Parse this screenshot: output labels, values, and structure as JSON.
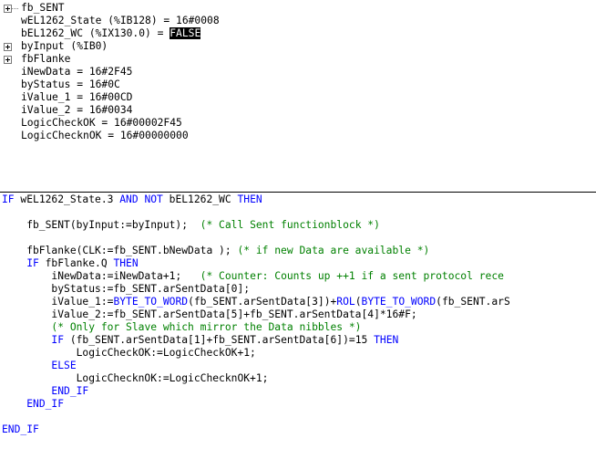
{
  "watch": {
    "rows": [
      {
        "expander": true,
        "connector": true,
        "text": "fb_SENT"
      },
      {
        "expander": false,
        "connector": false,
        "text": "wEL1262_State (%IB128) = 16#0008"
      },
      {
        "expander": false,
        "connector": false,
        "text": "bEL1262_WC (%IX130.0) = ",
        "highlight": "FALSE"
      },
      {
        "expander": true,
        "connector": false,
        "text": "byInput (%IB0)"
      },
      {
        "expander": true,
        "connector": false,
        "text": "fbFlanke"
      },
      {
        "expander": false,
        "connector": false,
        "text": "iNewData = 16#2F45"
      },
      {
        "expander": false,
        "connector": false,
        "text": "byStatus = 16#0C"
      },
      {
        "expander": false,
        "connector": false,
        "text": "iValue_1 = 16#00CD"
      },
      {
        "expander": false,
        "connector": false,
        "text": "iValue_2 = 16#0034"
      },
      {
        "expander": false,
        "connector": false,
        "text": "LogicCheckOK = 16#00002F45"
      },
      {
        "expander": false,
        "connector": false,
        "text": "LogicChecknOK = 16#00000000"
      }
    ]
  },
  "code": {
    "colors": {
      "keyword": "#0000ff",
      "comment": "#008000",
      "text": "#000000"
    },
    "lines": [
      [
        {
          "k": "kw",
          "t": "IF"
        },
        {
          "k": "tx",
          "t": " wEL1262_State.3 "
        },
        {
          "k": "kw",
          "t": "AND NOT"
        },
        {
          "k": "tx",
          "t": " bEL1262_WC "
        },
        {
          "k": "kw",
          "t": "THEN"
        }
      ],
      [],
      [
        {
          "k": "tx",
          "t": "    fb_SENT(byInput:=byInput);  "
        },
        {
          "k": "cm",
          "t": "(* Call Sent functionblock *)"
        }
      ],
      [],
      [
        {
          "k": "tx",
          "t": "    fbFlanke(CLK:=fb_SENT.bNewData ); "
        },
        {
          "k": "cm",
          "t": "(* if new Data are available *)"
        }
      ],
      [
        {
          "k": "tx",
          "t": "    "
        },
        {
          "k": "kw",
          "t": "IF"
        },
        {
          "k": "tx",
          "t": " fbFlanke.Q "
        },
        {
          "k": "kw",
          "t": "THEN"
        }
      ],
      [
        {
          "k": "tx",
          "t": "        iNewData:=iNewData+1;   "
        },
        {
          "k": "cm",
          "t": "(* Counter: Counts up ++1 if a sent protocol rece"
        }
      ],
      [
        {
          "k": "tx",
          "t": "        byStatus:=fb_SENT.arSentData[0];"
        }
      ],
      [
        {
          "k": "tx",
          "t": "        iValue_1:="
        },
        {
          "k": "kw",
          "t": "BYTE_TO_WORD"
        },
        {
          "k": "tx",
          "t": "(fb_SENT.arSentData[3])+"
        },
        {
          "k": "kw",
          "t": "ROL"
        },
        {
          "k": "tx",
          "t": "("
        },
        {
          "k": "kw",
          "t": "BYTE_TO_WORD"
        },
        {
          "k": "tx",
          "t": "(fb_SENT.arS"
        }
      ],
      [
        {
          "k": "tx",
          "t": "        iValue_2:=fb_SENT.arSentData[5]+fb_SENT.arSentData[4]*16#F;"
        }
      ],
      [
        {
          "k": "tx",
          "t": "        "
        },
        {
          "k": "cm",
          "t": "(* Only for Slave which mirror the Data nibbles *)"
        }
      ],
      [
        {
          "k": "tx",
          "t": "        "
        },
        {
          "k": "kw",
          "t": "IF"
        },
        {
          "k": "tx",
          "t": " (fb_SENT.arSentData[1]+fb_SENT.arSentData[6])=15 "
        },
        {
          "k": "kw",
          "t": "THEN"
        }
      ],
      [
        {
          "k": "tx",
          "t": "            LogicCheckOK:=LogicCheckOK+1;"
        }
      ],
      [
        {
          "k": "tx",
          "t": "        "
        },
        {
          "k": "kw",
          "t": "ELSE"
        }
      ],
      [
        {
          "k": "tx",
          "t": "            LogicChecknOK:=LogicChecknOK+1;"
        }
      ],
      [
        {
          "k": "tx",
          "t": "        "
        },
        {
          "k": "kw",
          "t": "END_IF"
        }
      ],
      [
        {
          "k": "tx",
          "t": "    "
        },
        {
          "k": "kw",
          "t": "END_IF"
        }
      ],
      [],
      [
        {
          "k": "kw",
          "t": "END_IF"
        }
      ]
    ]
  }
}
